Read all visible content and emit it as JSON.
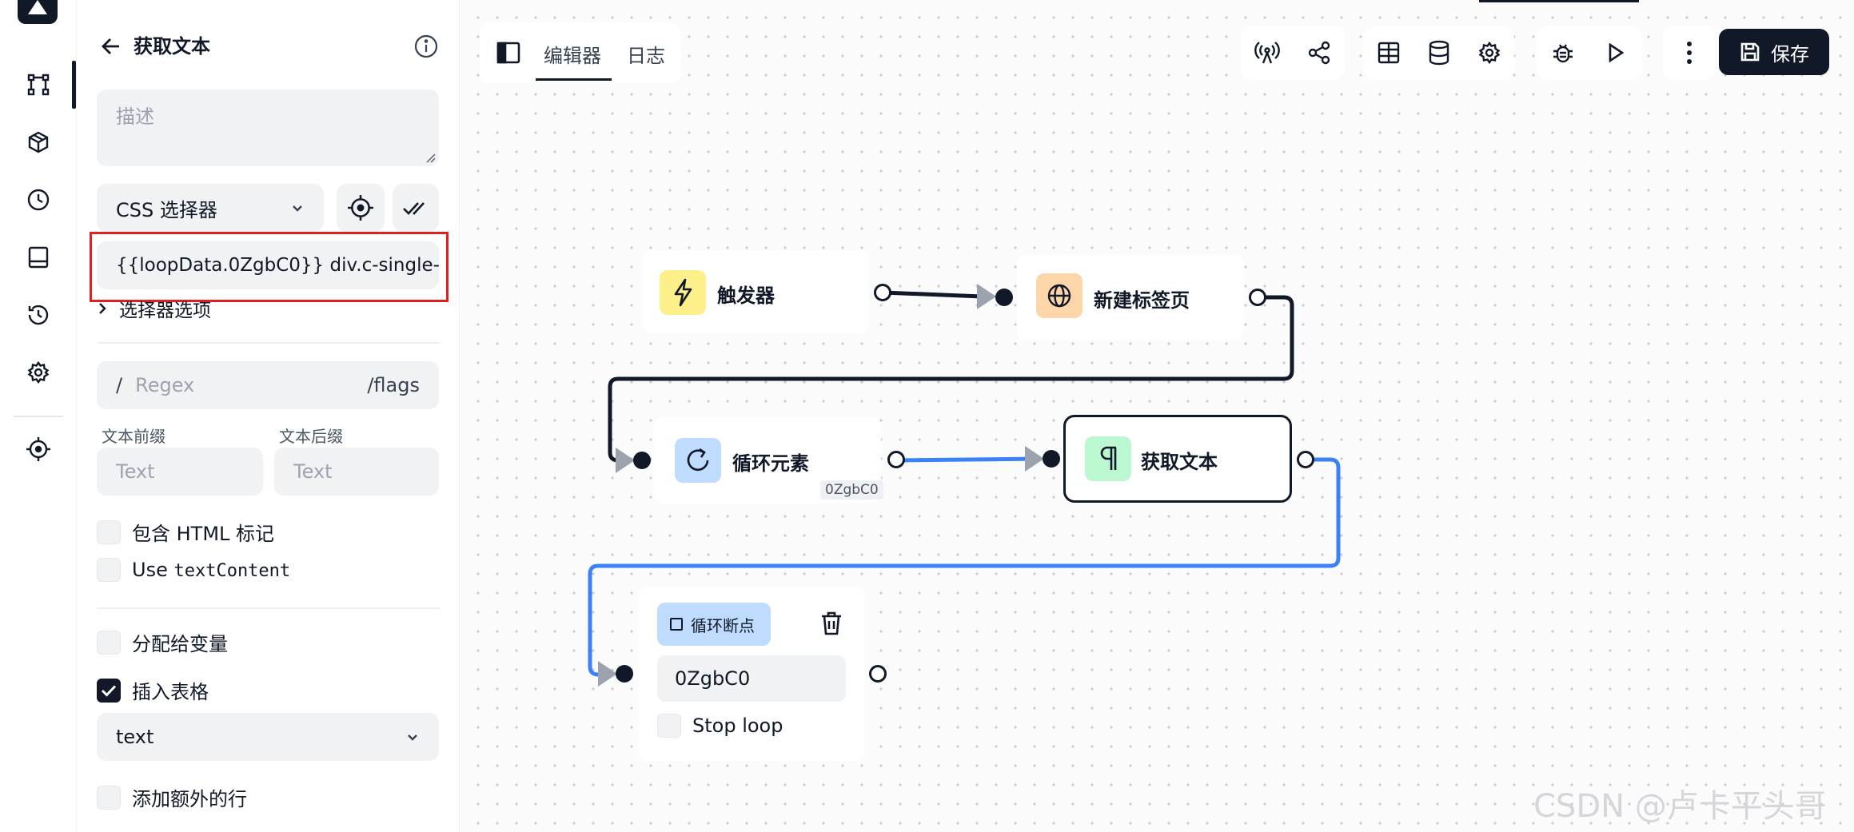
{
  "rail": {
    "icons": [
      "workflow-icon",
      "package-icon",
      "clock-icon",
      "storage-icon",
      "history-icon",
      "settings-icon",
      "crosshair-icon"
    ]
  },
  "panel": {
    "title": "获取文本",
    "description_placeholder": "描述",
    "selector_type": "CSS 选择器",
    "selector_value": "{{loopData.0ZgbC0}} div.c-single-",
    "selector_options_label": "选择器选项",
    "regex": {
      "prefix": "/",
      "placeholder": "Regex",
      "flags": "/flags"
    },
    "prefix_label": "文本前缀",
    "suffix_label": "文本后缀",
    "prefix_placeholder": "Text",
    "suffix_placeholder": "Text",
    "include_html_label": "包含 HTML 标记",
    "use_text_content_prefix": "Use ",
    "use_text_content_code": "textContent",
    "assign_variable_label": "分配给变量",
    "insert_table_label": "插入表格",
    "insert_table_checked": true,
    "column_value": "text",
    "add_row_label": "添加额外的行"
  },
  "toolbar": {
    "tab_editor": "编辑器",
    "tab_logs": "日志",
    "save_label": "保存"
  },
  "nodes": {
    "trigger": "触发器",
    "new_tab": "新建标签页",
    "loop": "循环元素",
    "loop_id": "0ZgbC0",
    "get_text": "获取文本",
    "loop_break": "循环断点",
    "loop_break_id": "0ZgbC0",
    "stop_loop_label": "Stop loop"
  },
  "colors": {
    "trigger_icon_bg": "#fdf08a",
    "new_tab_icon_bg": "#fcd6a8",
    "loop_icon_bg": "#bfdbfe",
    "get_text_icon_bg": "#bbf7d0",
    "edge_black": "#111827",
    "edge_blue": "#3b82f6",
    "highlight_red": "#e02020"
  },
  "watermark": "CSDN @卢卡平头哥"
}
